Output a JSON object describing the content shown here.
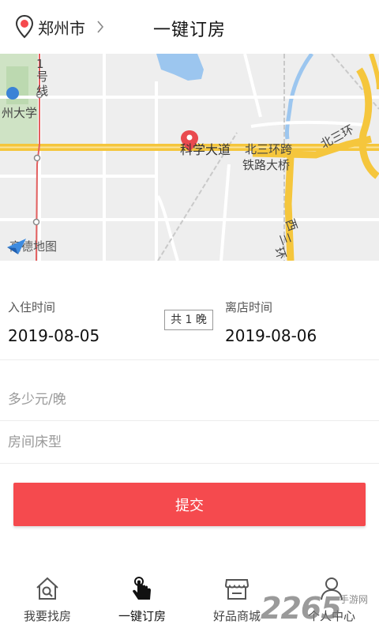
{
  "header": {
    "city": "郑州市",
    "title": "一键订房"
  },
  "map": {
    "labels": {
      "line1_a": "1",
      "line1_b": "号",
      "line1_c": "线",
      "university": "州大学",
      "road_main": "科学大道",
      "bridge_1": "北三环跨",
      "bridge_2": "铁路大桥",
      "north_ring": "北三环",
      "west_ring_1": "西",
      "west_ring_2": "三",
      "west_ring_3": "环"
    },
    "logo": "高德地图"
  },
  "booking": {
    "checkin_label": "入住时间",
    "checkin_date": "2019-08-05",
    "nights": "共 1 晚",
    "checkout_label": "离店时间",
    "checkout_date": "2019-08-06"
  },
  "form": {
    "price_placeholder": "多少元/晚",
    "room_placeholder": "房间床型",
    "submit_label": "提交"
  },
  "tabs": [
    {
      "label": "我要找房",
      "icon": "house-search-icon"
    },
    {
      "label": "一键订房",
      "icon": "tap-hand-icon"
    },
    {
      "label": "好品商城",
      "icon": "store-icon"
    },
    {
      "label": "个人中心",
      "icon": "user-icon"
    }
  ],
  "watermark": {
    "number": "2265",
    "text": "手游网"
  },
  "colors": {
    "accent": "#f54a4e",
    "map_road_yellow": "#f5c63c",
    "map_water": "#9cc6ef"
  }
}
